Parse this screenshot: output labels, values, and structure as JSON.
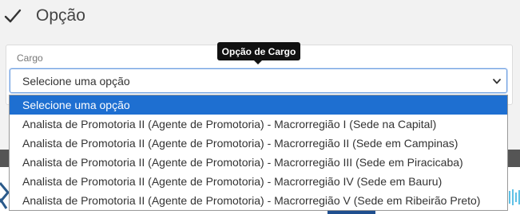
{
  "header": {
    "title": "Opção",
    "icon": "check-icon"
  },
  "field": {
    "label": "Cargo",
    "selected_value": "Selecione uma opção",
    "tooltip": "Opção de Cargo"
  },
  "dropdown": {
    "options": [
      {
        "label": "Selecione uma opção",
        "selected": true
      },
      {
        "label": "Analista de Promotoria II (Agente de Promotoria) - Macrorregião I (Sede na Capital)",
        "selected": false
      },
      {
        "label": "Analista de Promotoria II (Agente de Promotoria) - Macrorregião II (Sede em Campinas)",
        "selected": false
      },
      {
        "label": "Analista de Promotoria II (Agente de Promotoria) - Macrorregião III (Sede em Piracicaba)",
        "selected": false
      },
      {
        "label": "Analista de Promotoria II (Agente de Promotoria) - Macrorregião IV (Sede em Bauru)",
        "selected": false
      },
      {
        "label": "Analista de Promotoria II (Agente de Promotoria) - Macrorregião V (Sede em Ribeirão Preto)",
        "selected": false
      }
    ]
  },
  "colors": {
    "accent": "#1e6fd1",
    "focus_border": "#6e9fe0",
    "tooltip_bg": "#111111"
  }
}
